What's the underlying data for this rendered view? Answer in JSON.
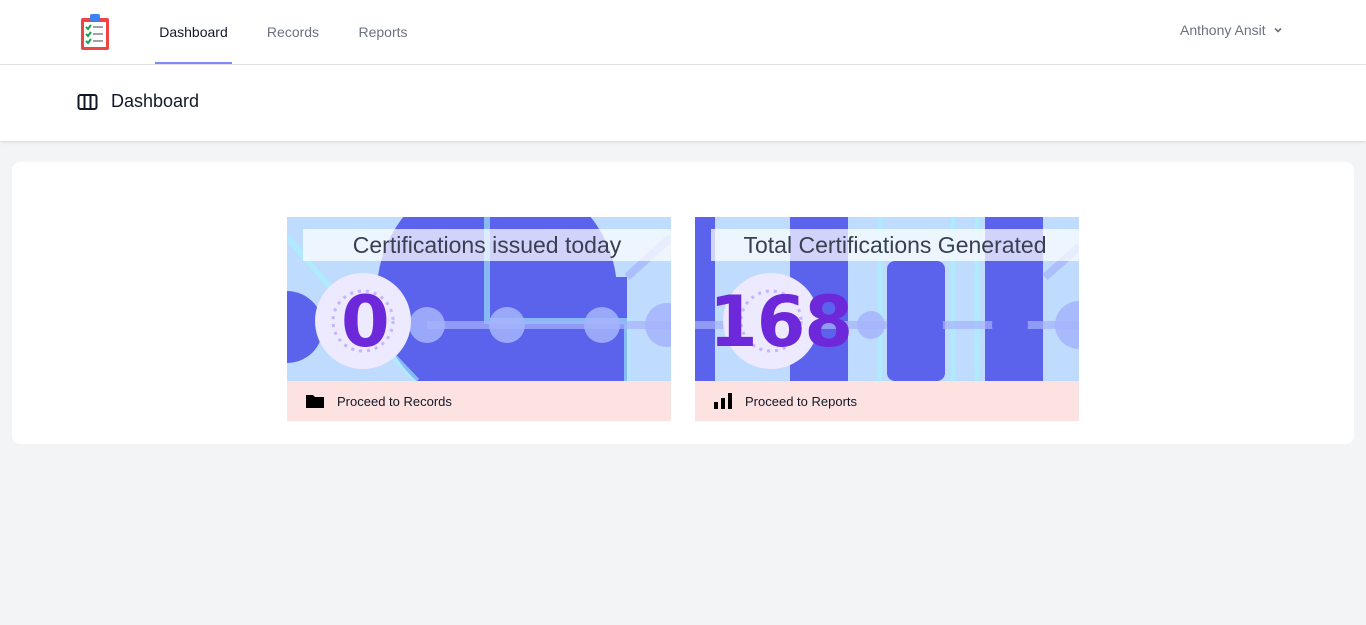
{
  "nav": {
    "links": [
      {
        "label": "Dashboard",
        "active": true
      },
      {
        "label": "Records",
        "active": false
      },
      {
        "label": "Reports",
        "active": false
      }
    ],
    "user_name": "Anthony Ansit"
  },
  "header": {
    "title": "Dashboard",
    "icon": "columns-icon"
  },
  "cards": [
    {
      "title": "Certifications issued today",
      "value": "0",
      "footer_label": "Proceed to Records",
      "footer_icon": "folder-icon"
    },
    {
      "title": "Total Certifications Generated",
      "value": "168",
      "footer_label": "Proceed to Reports",
      "footer_icon": "bar-chart-icon"
    }
  ],
  "colors": {
    "accent": "#818cf8",
    "value": "#6d28d9",
    "card_footer": "#fde2e2",
    "card_art_light": "#bfdbfe",
    "card_art_dark": "#5b63ec"
  }
}
